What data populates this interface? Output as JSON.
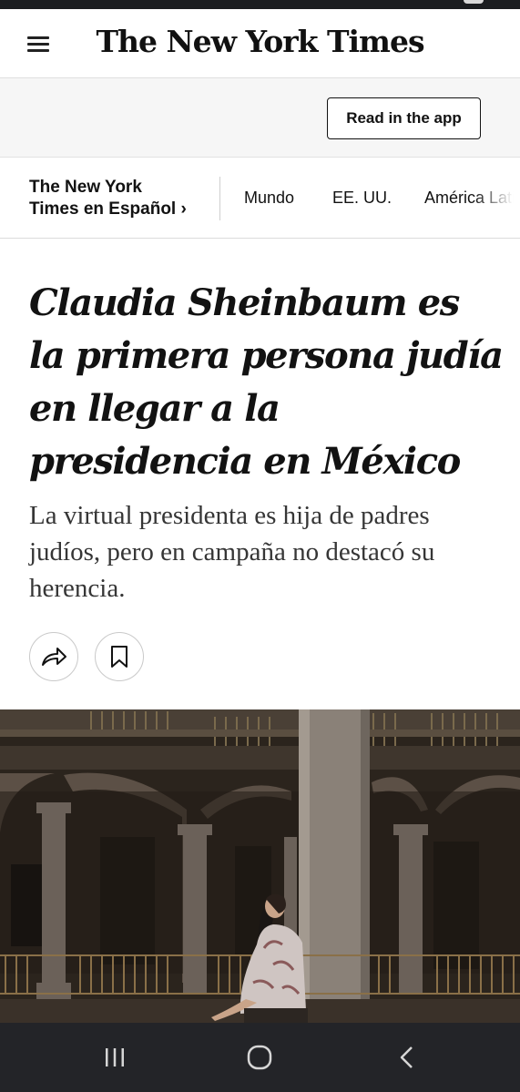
{
  "masthead": {
    "logo_text": "The New York Times",
    "menu_icon": "hamburger-menu-icon"
  },
  "app_promo": {
    "button_label": "Read in the app"
  },
  "section_nav": {
    "brand_line1": "The New York",
    "brand_line2": "Times en Español ›",
    "items": [
      "Mundo",
      "EE. UU.",
      "América Latina"
    ]
  },
  "article": {
    "headline": "Claudia Sheinbaum es la primera persona judía en llegar a la presidencia en México",
    "summary": "La virtual presidenta es hija de padres judíos, pero en campaña no destacó su herencia.",
    "share_icon": "share-arrow-icon",
    "save_icon": "bookmark-icon",
    "photo_subject": "woman-in-arched-courtyard"
  },
  "android_nav": {
    "recents_icon": "recent-apps-icon",
    "home_icon": "home-circle-icon",
    "back_icon": "back-chevron-icon"
  },
  "colors": {
    "text": "#121212",
    "promo_background": "#f6f6f6",
    "nav_bar": "#232428"
  }
}
